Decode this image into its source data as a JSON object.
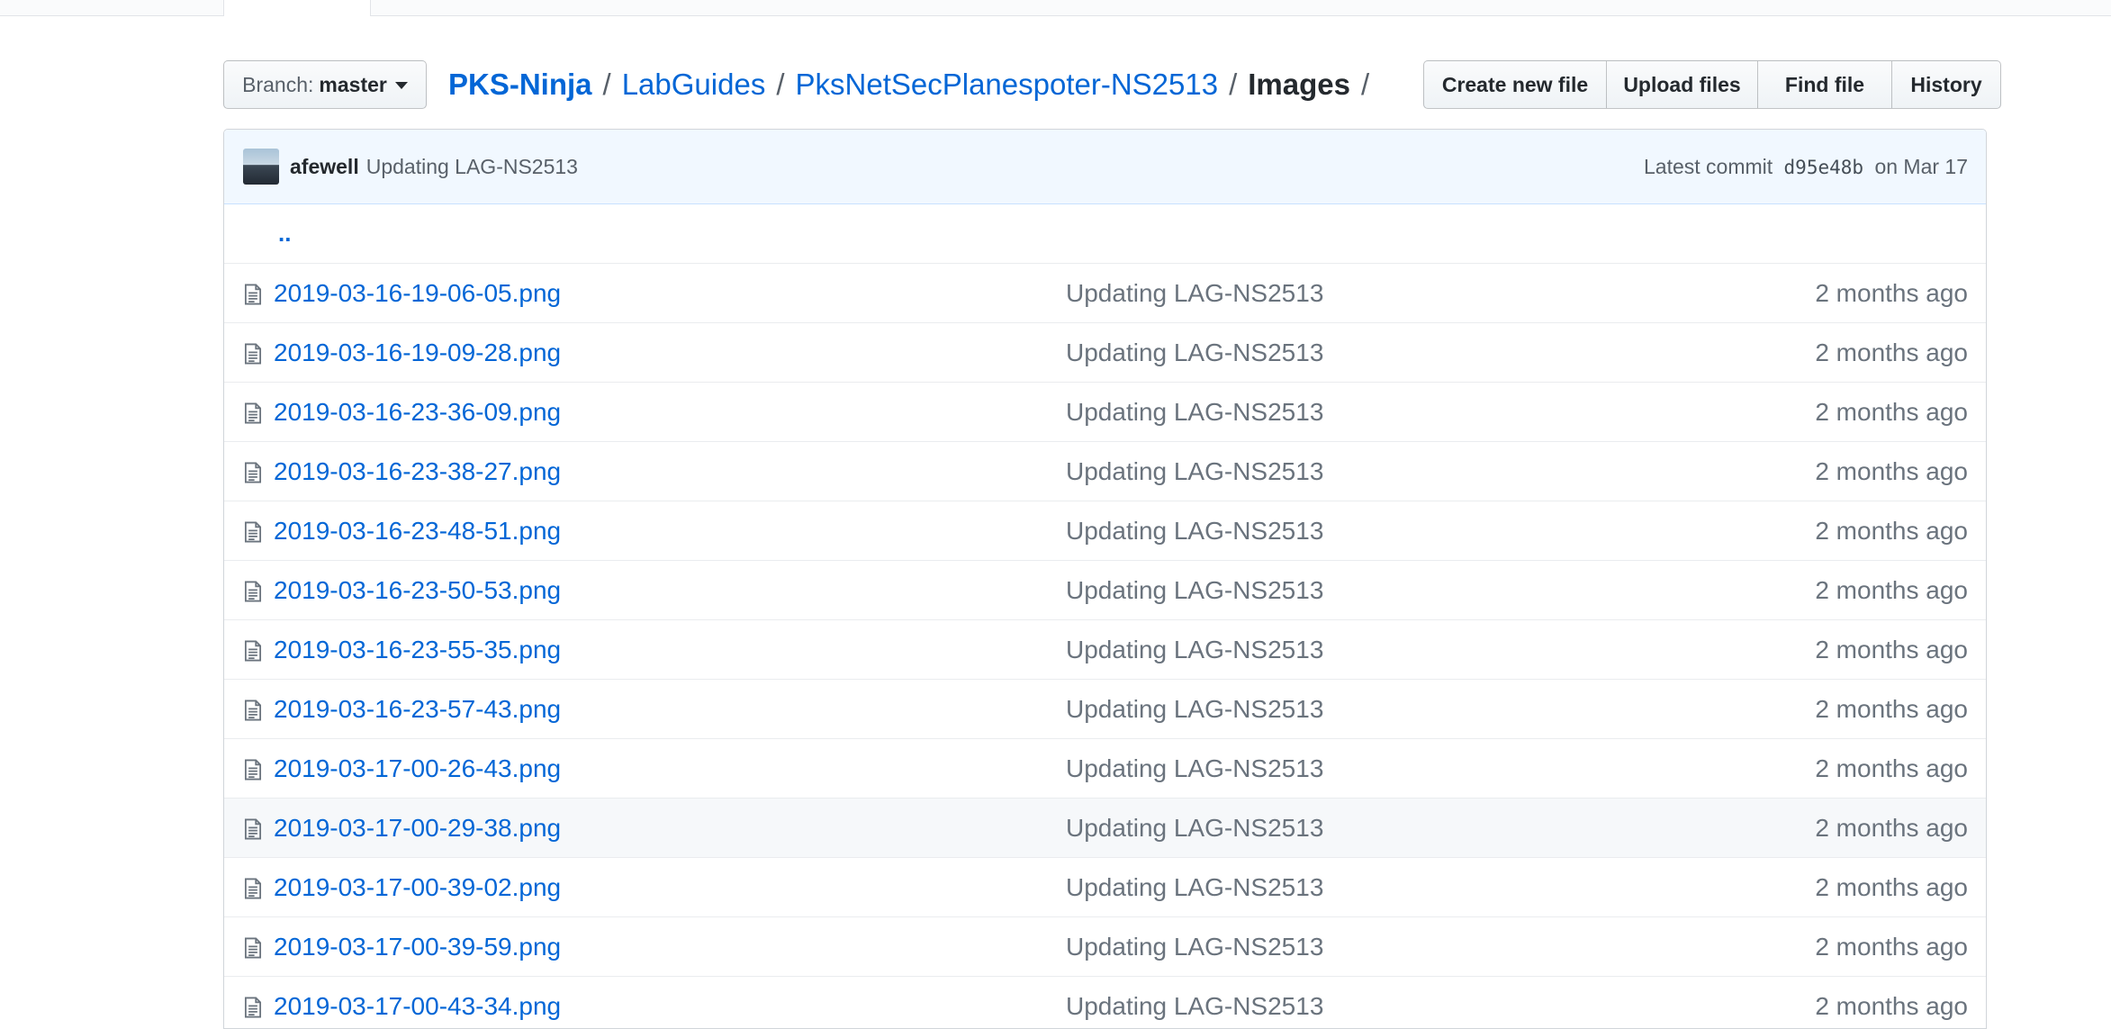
{
  "branch": {
    "label": "Branch:",
    "value": "master"
  },
  "breadcrumb": {
    "root": "PKS-Ninja",
    "parts": [
      "LabGuides",
      "PksNetSecPlanespoter-NS2513"
    ],
    "current": "Images",
    "separator": "/"
  },
  "actions": [
    "Create new file",
    "Upload files",
    "Find file",
    "History"
  ],
  "commit": {
    "author": "afewell",
    "message": "Updating LAG-NS2513",
    "latest_label": "Latest commit",
    "sha": "d95e48b",
    "date": "on Mar 17"
  },
  "up_link": "..",
  "icons": {
    "file": "file-icon",
    "branch_caret": "caret-down-icon"
  },
  "colors": {
    "link": "#0366d6",
    "commit_bg": "#f1f8ff",
    "row_hover": "#f6f8fa"
  },
  "files": [
    {
      "name": "2019-03-16-19-06-05.png",
      "message": "Updating LAG-NS2513",
      "age": "2 months ago"
    },
    {
      "name": "2019-03-16-19-09-28.png",
      "message": "Updating LAG-NS2513",
      "age": "2 months ago"
    },
    {
      "name": "2019-03-16-23-36-09.png",
      "message": "Updating LAG-NS2513",
      "age": "2 months ago"
    },
    {
      "name": "2019-03-16-23-38-27.png",
      "message": "Updating LAG-NS2513",
      "age": "2 months ago"
    },
    {
      "name": "2019-03-16-23-48-51.png",
      "message": "Updating LAG-NS2513",
      "age": "2 months ago"
    },
    {
      "name": "2019-03-16-23-50-53.png",
      "message": "Updating LAG-NS2513",
      "age": "2 months ago"
    },
    {
      "name": "2019-03-16-23-55-35.png",
      "message": "Updating LAG-NS2513",
      "age": "2 months ago"
    },
    {
      "name": "2019-03-16-23-57-43.png",
      "message": "Updating LAG-NS2513",
      "age": "2 months ago"
    },
    {
      "name": "2019-03-17-00-26-43.png",
      "message": "Updating LAG-NS2513",
      "age": "2 months ago"
    },
    {
      "name": "2019-03-17-00-29-38.png",
      "message": "Updating LAG-NS2513",
      "age": "2 months ago"
    },
    {
      "name": "2019-03-17-00-39-02.png",
      "message": "Updating LAG-NS2513",
      "age": "2 months ago"
    },
    {
      "name": "2019-03-17-00-39-59.png",
      "message": "Updating LAG-NS2513",
      "age": "2 months ago"
    },
    {
      "name": "2019-03-17-00-43-34.png",
      "message": "Updating LAG-NS2513",
      "age": "2 months ago"
    }
  ]
}
